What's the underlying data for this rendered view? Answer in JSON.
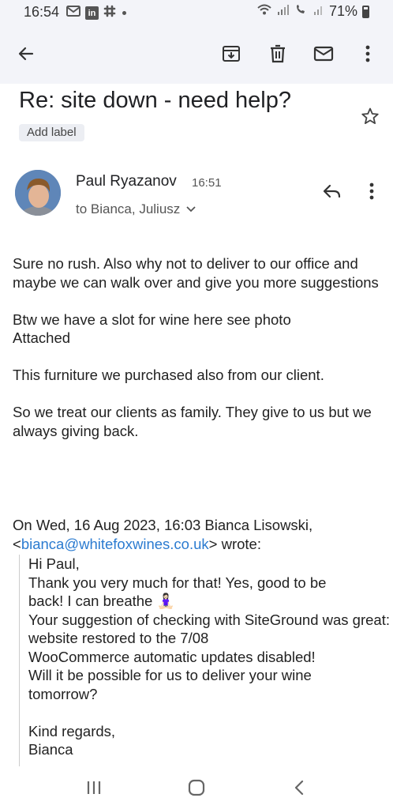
{
  "status_bar": {
    "time": "16:54",
    "battery": "71%",
    "notification_icons": [
      "gmail-icon",
      "linkedin-icon",
      "slack-icon"
    ]
  },
  "app_bar": {
    "back": "back-icon",
    "actions": [
      "archive-icon",
      "delete-icon",
      "mark-unread-icon",
      "more-vert-icon"
    ]
  },
  "email": {
    "subject": "Re: site down - need help?",
    "label_button": "Add label",
    "sender": "Paul Ryazanov",
    "time": "16:51",
    "recipients": "to Bianca, Juliusz",
    "body": [
      "Sure no rush. Also why not to deliver to our office and maybe we can walk over and give you more suggestions",
      "Btw we have a slot for wine here see photo Attached",
      "This furniture we purchased also from our client.",
      "So we treat our clients as family. They give to us but we always giving back."
    ],
    "quote_header_prefix": "On Wed, 16 Aug 2023, 16:03 Bianca Lisowski,",
    "quote_email_open": "<",
    "quote_email": "bianca@whitefoxwines.co.uk",
    "quote_email_close": "> wrote:",
    "quote_lines": [
      "Hi Paul,",
      "Thank you very much for that! Yes, good to be back! I can breathe 🧘🏻‍♀️",
      "Your suggestion of checking with SiteGround was great: website restored to the 7/08",
      "WooCommerce automatic updates disabled!",
      "Will it be possible for us to deliver your wine tomorrow?",
      "",
      "Kind regards,",
      "Bianca"
    ]
  },
  "nav_bar": [
    "recent-apps-icon",
    "home-icon",
    "back-nav-icon"
  ]
}
